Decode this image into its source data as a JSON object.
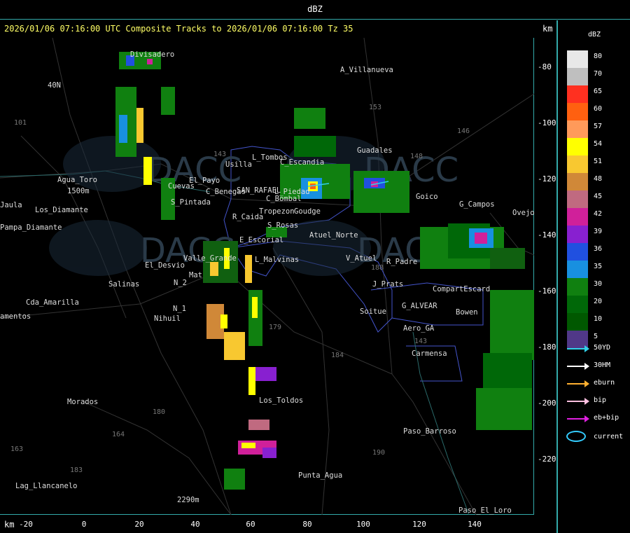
{
  "window": {
    "title": "dBZ"
  },
  "plot": {
    "title": "2026/01/06 07:16:00 UTC Composite Tracks to 2026/01/06 07:16:00 Tz 35",
    "unit_km_top": "km",
    "unit_km_bottom": "km",
    "y_ticks": [
      "-80",
      "-100",
      "-120",
      "-140",
      "-160",
      "-180",
      "-200",
      "-220"
    ],
    "x_ticks": [
      "-20",
      "0",
      "20",
      "40",
      "60",
      "80",
      "100",
      "120",
      "140"
    ]
  },
  "legend": {
    "unit": "dBZ",
    "scale": [
      {
        "value": "80",
        "color": "#e8e8e8"
      },
      {
        "value": "70",
        "color": "#bfbfbf"
      },
      {
        "value": "65",
        "color": "#ff3020"
      },
      {
        "value": "60",
        "color": "#ff6010"
      },
      {
        "value": "57",
        "color": "#ff9a5a"
      },
      {
        "value": "54",
        "color": "#ffff00"
      },
      {
        "value": "51",
        "color": "#f8c830"
      },
      {
        "value": "48",
        "color": "#d08838"
      },
      {
        "value": "45",
        "color": "#c06a80"
      },
      {
        "value": "42",
        "color": "#d0209a"
      },
      {
        "value": "39",
        "color": "#8820d0"
      },
      {
        "value": "36",
        "color": "#2050e0"
      },
      {
        "value": "35",
        "color": "#1890e0"
      },
      {
        "value": "30",
        "color": "#108010"
      },
      {
        "value": "20",
        "color": "#006808"
      },
      {
        "value": "10",
        "color": "#005800"
      },
      {
        "value": "5",
        "color": "#503888"
      }
    ],
    "tracks": [
      {
        "label": "50YD",
        "color": "#30d0e8"
      },
      {
        "label": "30HM",
        "color": "#ffffff"
      },
      {
        "label": "eburn",
        "color": "#ffb030"
      },
      {
        "label": "bip",
        "color": "#ffc0e0"
      },
      {
        "label": "eb+bip",
        "color": "#e020e0"
      }
    ],
    "current_label": "current"
  },
  "places": [
    {
      "name": "Divisadero"
    },
    {
      "name": "A_Villanueva"
    },
    {
      "name": "Guadales"
    },
    {
      "name": "L_Tombos"
    },
    {
      "name": "Usilla"
    },
    {
      "name": "C_Escandia"
    },
    {
      "name": "Agua_Toro"
    },
    {
      "name": "1500m"
    },
    {
      "name": "Jaula"
    },
    {
      "name": "Los_Diamante"
    },
    {
      "name": "Pampa_Diamante"
    },
    {
      "name": "El_Payo"
    },
    {
      "name": "Cuevas"
    },
    {
      "name": "C_Benegas"
    },
    {
      "name": "SAN_RAFAEL"
    },
    {
      "name": "L_Piedad"
    },
    {
      "name": "C_Bombal"
    },
    {
      "name": "Goudge"
    },
    {
      "name": "Tropezon"
    },
    {
      "name": "R_Caida"
    },
    {
      "name": "S_Rosas"
    },
    {
      "name": "Atuel_Norte"
    },
    {
      "name": "E_Escorial"
    },
    {
      "name": "Valle_Grande"
    },
    {
      "name": "L_Malvinas"
    },
    {
      "name": "El_Desvio"
    },
    {
      "name": "Salinas"
    },
    {
      "name": "Cda_Amarilla"
    },
    {
      "name": "amentos"
    },
    {
      "name": "N_1"
    },
    {
      "name": "Nihuil"
    },
    {
      "name": "V_Atuel"
    },
    {
      "name": "R_Padre"
    },
    {
      "name": "J_Prats"
    },
    {
      "name": "CompartEscard"
    },
    {
      "name": "G_ALVEAR"
    },
    {
      "name": "Soitue"
    },
    {
      "name": "Bowen"
    },
    {
      "name": "Aero_GA"
    },
    {
      "name": "Carmensa"
    },
    {
      "name": "Morados"
    },
    {
      "name": "Los_Toldos"
    },
    {
      "name": "Paso_Barroso"
    },
    {
      "name": "Punta_Agua"
    },
    {
      "name": "Lag_Llancanelo"
    },
    {
      "name": "2290m"
    },
    {
      "name": "Paso_El_Loro"
    },
    {
      "name": "G_Campos"
    },
    {
      "name": "Goico"
    },
    {
      "name": "Ovejo"
    },
    {
      "name": "S_Pintada"
    },
    {
      "name": "N_2"
    },
    {
      "name": "Mat"
    },
    {
      "name": "40N"
    }
  ],
  "roads": [
    "153",
    "146",
    "101",
    "143",
    "148",
    "184",
    "179",
    "180",
    "183",
    "190",
    "188",
    "164",
    "163",
    "143"
  ],
  "watermark": {
    "text": "DACC"
  }
}
